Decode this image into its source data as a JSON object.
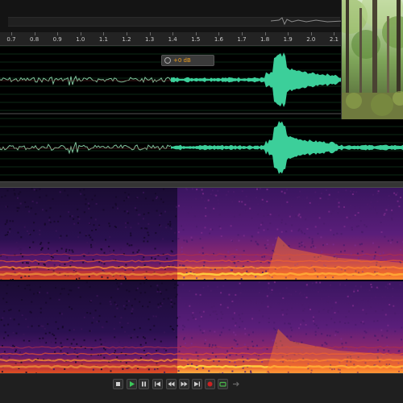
{
  "ruler": {
    "ticks": [
      "0.7",
      "0.8",
      "0.9",
      "1.0",
      "1.1",
      "1.2",
      "1.3",
      "1.4",
      "1.5",
      "1.6",
      "1.7",
      "1.8",
      "1.9",
      "2.0",
      "2.1"
    ]
  },
  "hud": {
    "volume_label": "+0 dB"
  },
  "transport": {
    "buttons": [
      {
        "icon": "stop-icon"
      },
      {
        "icon": "play-icon"
      },
      {
        "icon": "pause-icon"
      },
      {
        "icon": "skip-to-start-icon"
      },
      {
        "icon": "rewind-icon"
      },
      {
        "icon": "fast-forward-icon"
      },
      {
        "icon": "skip-to-end-icon"
      },
      {
        "icon": "record-icon"
      },
      {
        "icon": "loop-icon"
      },
      {
        "icon": "skip-selection-icon"
      }
    ]
  },
  "colors": {
    "waveform_selected": "#3ccf9a",
    "waveform_unselected": "#7fc39c",
    "spectral_low": "#1a0a3a",
    "spectral_high": "#ffd040",
    "record": "#cc2222",
    "accent": "#f0a020"
  },
  "video": {
    "subject": "forest"
  }
}
